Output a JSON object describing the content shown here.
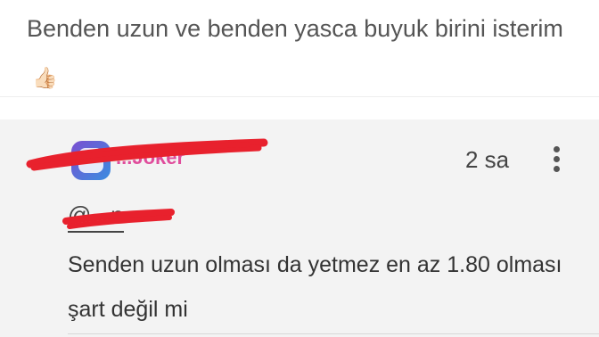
{
  "top_post": {
    "text": "Benden uzun ve benden yasca buyuk birini isterim",
    "emoji": "👍🏻"
  },
  "reply": {
    "username": "...Joker",
    "time": "2 sa",
    "mention": "@...n",
    "text": "Senden uzun olması da yetmez en az 1.80 olması şart değil mi"
  },
  "icons": {
    "more": "more-vertical-icon",
    "avatar": "avatar-image"
  },
  "colors": {
    "redaction": "#e8212d",
    "username": "#e04d9c",
    "card_bg": "#f3f3f3"
  }
}
